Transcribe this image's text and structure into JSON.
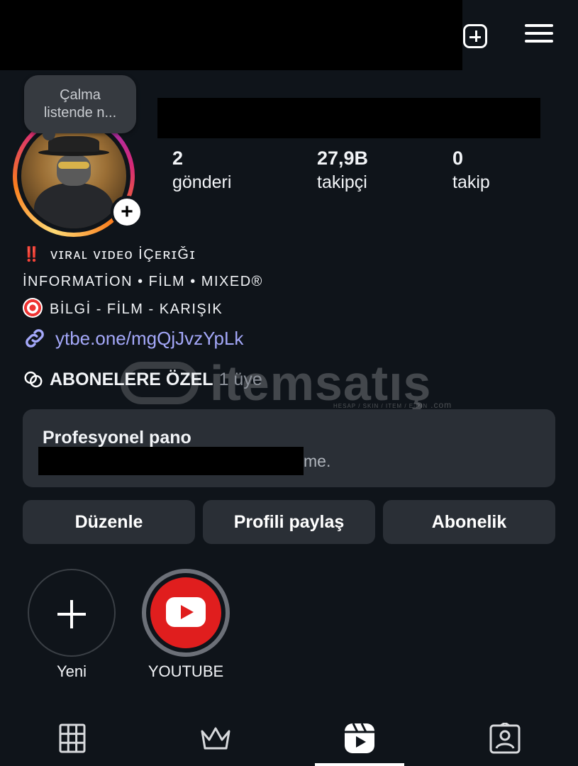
{
  "header": {
    "create_icon": "plus-square-icon",
    "menu_icon": "hamburger-menu-icon"
  },
  "note": {
    "text_line1": "Çalma",
    "text_line2": "listende n..."
  },
  "stats": [
    {
      "value": "2",
      "label": "gönderi"
    },
    {
      "value": "27,9B",
      "label": "takipçi"
    },
    {
      "value": "0",
      "label": "takip"
    }
  ],
  "bio": {
    "line1_emoji": "‼️",
    "line1_text": "ᴠɪʀᴀʟ ᴠɪᴅᴇᴏ İÇᴇʀɪǦɪ",
    "line2_text": "İNFORMATİON • FİLM • MIXED®",
    "line3_text": "BİLGİ - FİLM - KARIŞIK",
    "link": "ytbe.one/mgQjJvzYpLk"
  },
  "subscribers": {
    "title": "ABONELERE ÖZEL",
    "count": "1 üye"
  },
  "watermark": {
    "text": "itemsatış",
    "subtext": "HESAP / SKIN / ITEM / E-PIN",
    "suffix": ".com"
  },
  "pro_dashboard": {
    "title": "Profesyonel pano",
    "subtitle_visible": "me."
  },
  "buttons": {
    "edit": "Düzenle",
    "share": "Profili paylaş",
    "subscription": "Abonelik"
  },
  "highlights": [
    {
      "label": "Yeni"
    },
    {
      "label": "YOUTUBE"
    }
  ],
  "tabs": [
    "grid-icon",
    "crown-icon",
    "reels-icon",
    "tagged-icon"
  ],
  "colors": {
    "background": "#0f141a",
    "card": "#2a2f36",
    "link": "#a4a8f9",
    "youtube_red": "#e01e1e"
  }
}
